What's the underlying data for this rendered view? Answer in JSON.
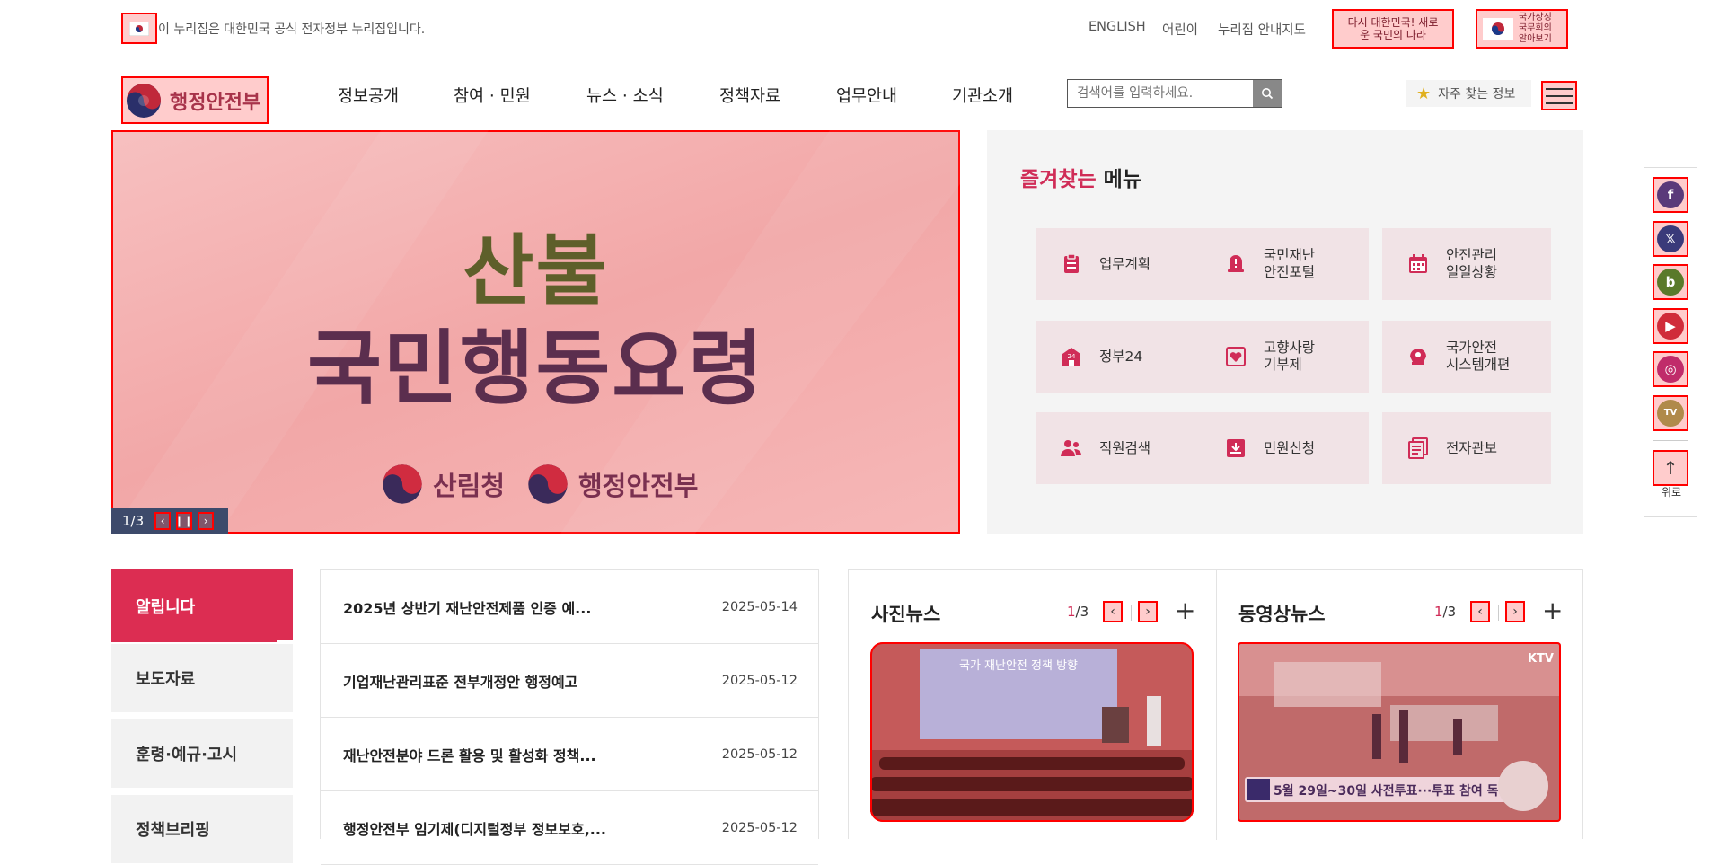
{
  "topbar": {
    "gov_notice": "이 누리집은 대한민국 공식 전자정부 누리집입니다.",
    "links": [
      "ENGLISH",
      "어린이",
      "누리집 안내지도"
    ],
    "badge1_text": "다시 대한민국! 새로운 국민의 나라",
    "badge2_text": "국가상징 국무회의 알아보기"
  },
  "header": {
    "logo_text": "행정안전부",
    "nav": [
      "정보공개",
      "참여 · 민원",
      "뉴스 · 소식",
      "정책자료",
      "업무안내",
      "기관소개"
    ],
    "search_placeholder": "검색어를 입력하세요.",
    "fav_info_label": "자주 찾는 정보"
  },
  "banner": {
    "headline1": "산불",
    "headline2": "국민행동요령",
    "org1": "산림청",
    "org2": "행정안전부",
    "slide_counter": "1/3"
  },
  "favorites": {
    "title_highlight": "즐겨찾는",
    "title_rest": "메뉴",
    "items": [
      {
        "line1": "업무계획",
        "line2": "",
        "icon": "clipboard-icon"
      },
      {
        "line1": "국민재난",
        "line2": "안전포털",
        "icon": "alert-bell-icon"
      },
      {
        "line1": "안전관리",
        "line2": "일일상황",
        "icon": "calendar-icon"
      },
      {
        "line1": "정부24",
        "line2": "",
        "icon": "gov24-icon"
      },
      {
        "line1": "고향사랑",
        "line2": "기부제",
        "icon": "heart-icon"
      },
      {
        "line1": "국가안전",
        "line2": "시스템개편",
        "icon": "safety-hand-icon"
      },
      {
        "line1": "직원검색",
        "line2": "",
        "icon": "people-icon"
      },
      {
        "line1": "민원신청",
        "line2": "",
        "icon": "download-box-icon"
      },
      {
        "line1": "전자관보",
        "line2": "",
        "icon": "document-list-icon"
      }
    ]
  },
  "sns": {
    "items": [
      {
        "name": "facebook-icon",
        "glyph": "f",
        "color": "#5a3a7a"
      },
      {
        "name": "x-icon",
        "glyph": "𝕏",
        "color": "#3a3a7a"
      },
      {
        "name": "blog-icon",
        "glyph": "b",
        "color": "#5a7a2a"
      },
      {
        "name": "youtube-icon",
        "glyph": "▶",
        "color": "#d02c3a"
      },
      {
        "name": "instagram-icon",
        "glyph": "◎",
        "color": "#c02c6a"
      },
      {
        "name": "tv-icon",
        "glyph": "TV",
        "color": "#b08a4a"
      }
    ],
    "top_label": "위로"
  },
  "notices": {
    "tabs": [
      "알립니다",
      "보도자료",
      "훈령·예규·고시",
      "정책브리핑"
    ],
    "rows": [
      {
        "title": "2025년 상반기 재난안전제품 인증 예...",
        "date": "2025-05-14"
      },
      {
        "title": "기업재난관리표준 전부개정안 행정예고",
        "date": "2025-05-12"
      },
      {
        "title": "재난안전분야 드론 활용 및 활성화 정책...",
        "date": "2025-05-12"
      },
      {
        "title": "행정안전부 임기제(디지털정부 정보보호,...",
        "date": "2025-05-12"
      }
    ]
  },
  "media": {
    "photo": {
      "title": "사진뉴스",
      "page_current": "1",
      "page_total": "/3",
      "image_text": "국가 재난안전 정책 방향"
    },
    "video": {
      "title": "동영상뉴스",
      "page_current": "1",
      "page_total": "/3",
      "channel": "KTV",
      "caption": "5월 29일~30일 사전투표···투표 참여 독려"
    }
  }
}
